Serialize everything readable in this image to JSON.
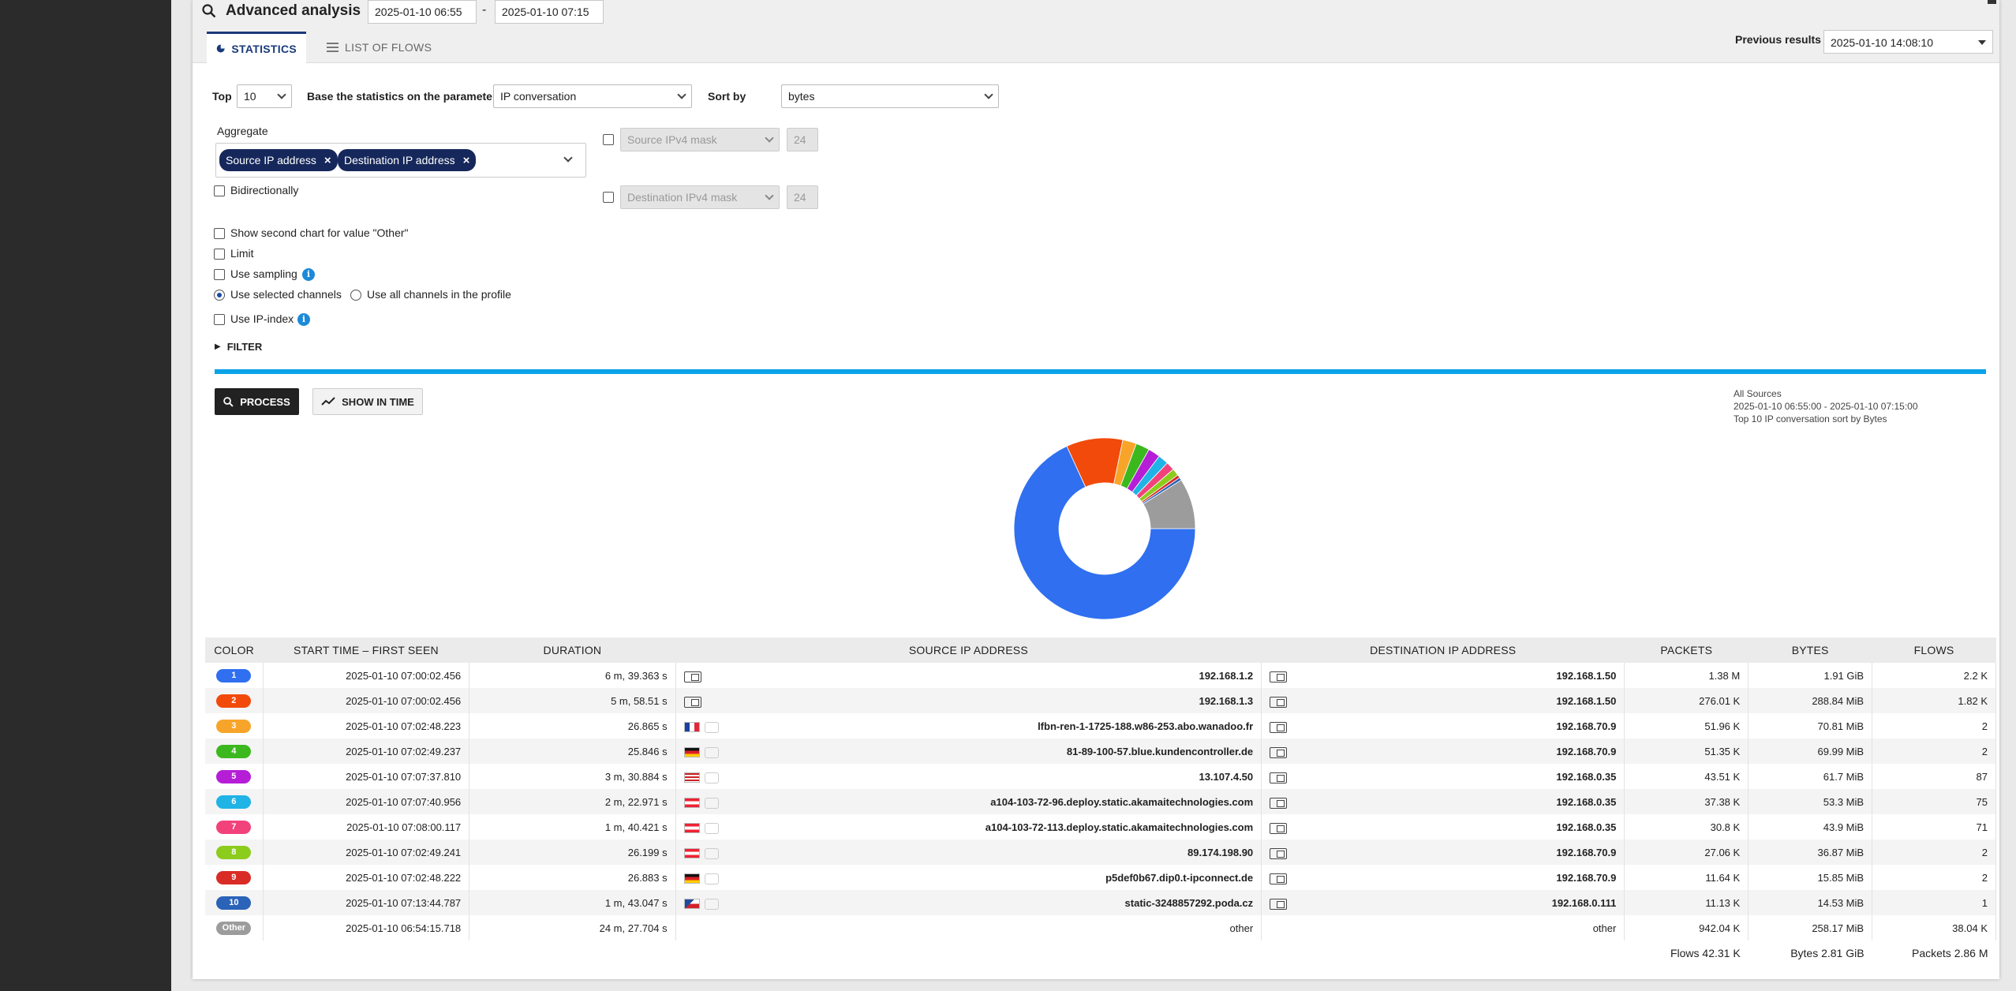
{
  "title": "Advanced analysis",
  "date_from": "2025-01-10 06:55",
  "date_to": "2025-01-10 07:15",
  "date_separator": "-",
  "tabs": [
    {
      "label": "STATISTICS",
      "icon": "pie-chart-icon",
      "active": true
    },
    {
      "label": "LIST OF FLOWS",
      "icon": "list-icon",
      "active": false
    }
  ],
  "previous_results": {
    "label": "Previous results",
    "value": "2025-01-10 14:08:10"
  },
  "form": {
    "top_label": "Top",
    "top_value": "10",
    "base_label": "Base the statistics on the parameter",
    "base_value": "IP conversation",
    "sort_label": "Sort by",
    "sort_value": "bytes",
    "aggregate_label": "Aggregate",
    "aggregate_chips": [
      "Source IP address",
      "Destination IP address"
    ],
    "src_mask_placeholder": "Source IPv4 mask",
    "src_mask_value": "24",
    "dst_mask_placeholder": "Destination IPv4 mask",
    "dst_mask_value": "24",
    "bidirectionally": "Bidirectionally",
    "second_chart": "Show second chart for value \"Other\"",
    "limit": "Limit",
    "use_sampling": "Use sampling",
    "use_selected_channels": "Use selected channels",
    "use_all_channels": "Use all channels in the profile",
    "use_ip_index": "Use IP-index",
    "filter": "FILTER"
  },
  "buttons": {
    "process": "PROCESS",
    "show_in_time": "SHOW IN TIME"
  },
  "chart_info": {
    "line1": "All Sources",
    "line2": "2025-01-10 06:55:00 - 2025-01-10 07:15:00",
    "line3": "Top 10 IP conversation sort by Bytes"
  },
  "chart_data": {
    "type": "pie",
    "title": "Top 10 IP conversation sort by Bytes",
    "categories": [
      "1",
      "2",
      "3",
      "4",
      "5",
      "6",
      "7",
      "8",
      "9",
      "10",
      "Other"
    ],
    "values": [
      1955.84,
      288.84,
      70.81,
      69.99,
      61.7,
      53.3,
      43.9,
      36.87,
      15.85,
      14.53,
      258.17
    ],
    "unit": "MiB",
    "colors": [
      "#2f6ff0",
      "#f24a0a",
      "#f7a52a",
      "#3cb81f",
      "#b51ed6",
      "#1fb3e6",
      "#f2427b",
      "#8ccc1c",
      "#d92c26",
      "#2a63b8",
      "#9c9c9c"
    ],
    "donut": true
  },
  "table": {
    "headers": [
      "COLOR",
      "START TIME – FIRST SEEN",
      "DURATION",
      "SOURCE IP ADDRESS",
      "DESTINATION IP ADDRESS",
      "PACKETS",
      "BYTES",
      "FLOWS"
    ],
    "rows": [
      {
        "color": "1",
        "badge": "#2f6ff0",
        "start": "2025-01-10 07:00:02.456",
        "duration": "6 m, 39.363 s",
        "src_flags": [],
        "src": "192.168.1.2",
        "dst": "192.168.1.50",
        "packets": "1.38 M",
        "bytes": "1.91 GiB",
        "flows": "2.2 K"
      },
      {
        "color": "2",
        "badge": "#f24a0a",
        "start": "2025-01-10 07:00:02.456",
        "duration": "5 m, 58.51 s",
        "src_flags": [],
        "src": "192.168.1.3",
        "dst": "192.168.1.50",
        "packets": "276.01 K",
        "bytes": "288.84 MiB",
        "flows": "1.82 K"
      },
      {
        "color": "3",
        "badge": "#f7a52a",
        "start": "2025-01-10 07:02:48.223",
        "duration": "26.865 s",
        "src_flags": [
          "fr"
        ],
        "src": "lfbn-ren-1-1725-188.w86-253.abo.wanadoo.fr",
        "dst": "192.168.70.9",
        "packets": "51.96 K",
        "bytes": "70.81 MiB",
        "flows": "2"
      },
      {
        "color": "4",
        "badge": "#3cb81f",
        "start": "2025-01-10 07:02:49.237",
        "duration": "25.846 s",
        "src_flags": [
          "de"
        ],
        "src": "81-89-100-57.blue.kundencontroller.de",
        "dst": "192.168.70.9",
        "packets": "51.35 K",
        "bytes": "69.99 MiB",
        "flows": "2"
      },
      {
        "color": "5",
        "badge": "#b51ed6",
        "start": "2025-01-10 07:07:37.810",
        "duration": "3 m, 30.884 s",
        "src_flags": [
          "us"
        ],
        "src": "13.107.4.50",
        "dst": "192.168.0.35",
        "packets": "43.51 K",
        "bytes": "61.7 MiB",
        "flows": "87"
      },
      {
        "color": "6",
        "badge": "#1fb3e6",
        "start": "2025-01-10 07:07:40.956",
        "duration": "2 m, 22.971 s",
        "src_flags": [
          "at"
        ],
        "src": "a104-103-72-96.deploy.static.akamaitechnologies.com",
        "dst": "192.168.0.35",
        "packets": "37.38 K",
        "bytes": "53.3 MiB",
        "flows": "75"
      },
      {
        "color": "7",
        "badge": "#f2427b",
        "start": "2025-01-10 07:08:00.117",
        "duration": "1 m, 40.421 s",
        "src_flags": [
          "at"
        ],
        "src": "a104-103-72-113.deploy.static.akamaitechnologies.com",
        "dst": "192.168.0.35",
        "packets": "30.8 K",
        "bytes": "43.9 MiB",
        "flows": "71"
      },
      {
        "color": "8",
        "badge": "#8ccc1c",
        "start": "2025-01-10 07:02:49.241",
        "duration": "26.199 s",
        "src_flags": [
          "at"
        ],
        "src": "89.174.198.90",
        "dst": "192.168.70.9",
        "packets": "27.06 K",
        "bytes": "36.87 MiB",
        "flows": "2"
      },
      {
        "color": "9",
        "badge": "#d92c26",
        "start": "2025-01-10 07:02:48.222",
        "duration": "26.883 s",
        "src_flags": [
          "de"
        ],
        "src": "p5def0b67.dip0.t-ipconnect.de",
        "dst": "192.168.70.9",
        "packets": "11.64 K",
        "bytes": "15.85 MiB",
        "flows": "2"
      },
      {
        "color": "10",
        "badge": "#2a63b8",
        "start": "2025-01-10 07:13:44.787",
        "duration": "1 m, 43.047 s",
        "src_flags": [
          "cz"
        ],
        "src": "static-3248857292.poda.cz",
        "dst": "192.168.0.111",
        "packets": "11.13 K",
        "bytes": "14.53 MiB",
        "flows": "1"
      },
      {
        "color": "Other",
        "badge": "#9c9c9c",
        "start": "2025-01-10 06:54:15.718",
        "duration": "24 m, 27.704 s",
        "src_flags": [],
        "src": "other",
        "dst": "other",
        "packets": "942.04 K",
        "bytes": "258.17 MiB",
        "flows": "38.04 K"
      }
    ],
    "summary": {
      "flows": "Flows 42.31 K",
      "bytes": "Bytes 2.81 GiB",
      "packets": "Packets 2.86 M"
    }
  }
}
